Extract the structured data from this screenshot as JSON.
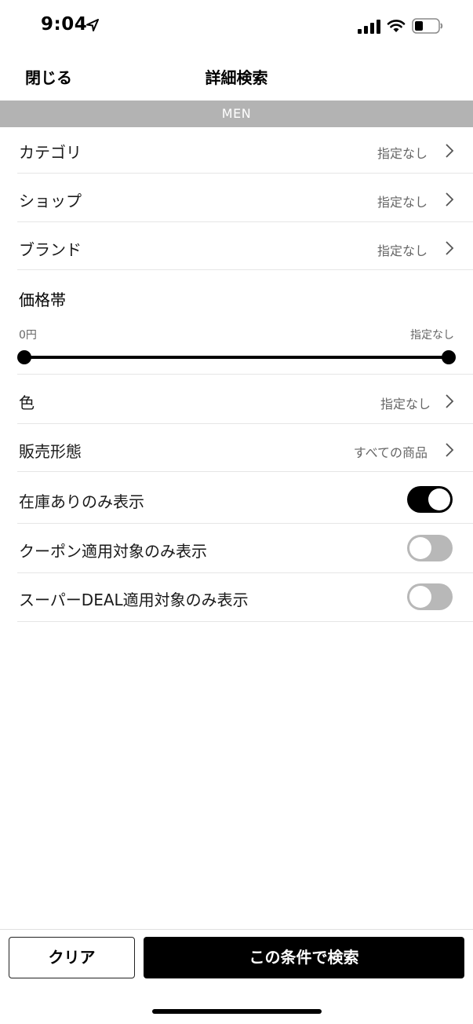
{
  "status_bar": {
    "time": "9:04"
  },
  "header": {
    "close_label": "閉じる",
    "title": "詳細検索"
  },
  "section": {
    "label": "MEN"
  },
  "filters": {
    "category": {
      "label": "カテゴリ",
      "value": "指定なし"
    },
    "shop": {
      "label": "ショップ",
      "value": "指定なし"
    },
    "brand": {
      "label": "ブランド",
      "value": "指定なし"
    },
    "color": {
      "label": "色",
      "value": "指定なし"
    },
    "sales_type": {
      "label": "販売形態",
      "value": "すべての商品"
    }
  },
  "price": {
    "title": "価格帯",
    "min_label": "0円",
    "max_label": "指定なし"
  },
  "toggles": {
    "in_stock": {
      "label": "在庫ありのみ表示",
      "on": true
    },
    "coupon": {
      "label": "クーポン適用対象のみ表示",
      "on": false
    },
    "super_deal": {
      "label": "スーパーDEAL適用対象のみ表示",
      "on": false
    }
  },
  "footer": {
    "clear_label": "クリア",
    "search_label": "この条件で検索"
  }
}
